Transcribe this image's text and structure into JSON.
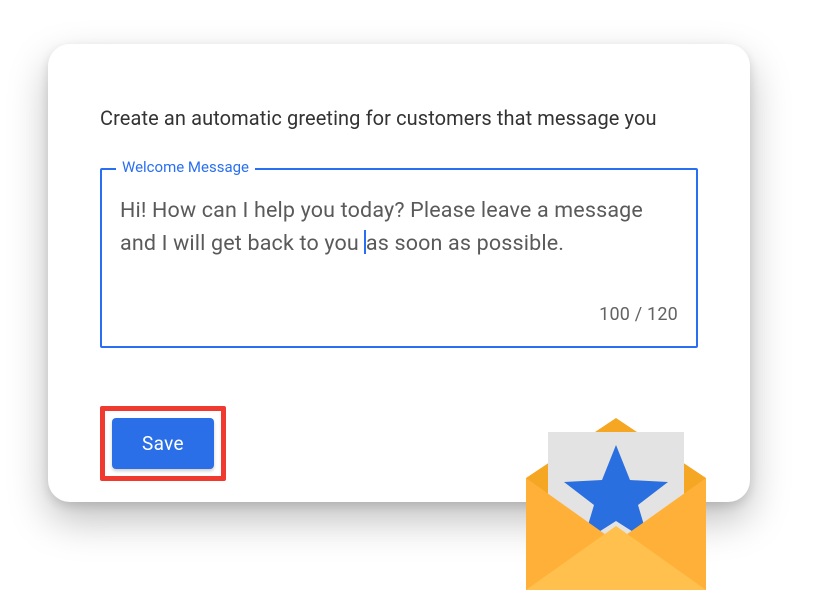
{
  "prompt": "Create an automatic greeting for customers that message you",
  "field": {
    "label": "Welcome Message",
    "value_before_caret": "Hi! How can I help you today? Please leave a message and I will get back to you ",
    "value_after_caret": "as soon as possible.",
    "count_current": "100",
    "count_max": "120",
    "counter_sep": " / "
  },
  "buttons": {
    "save": "Save"
  },
  "icons": {
    "envelope": "envelope-star-icon"
  }
}
